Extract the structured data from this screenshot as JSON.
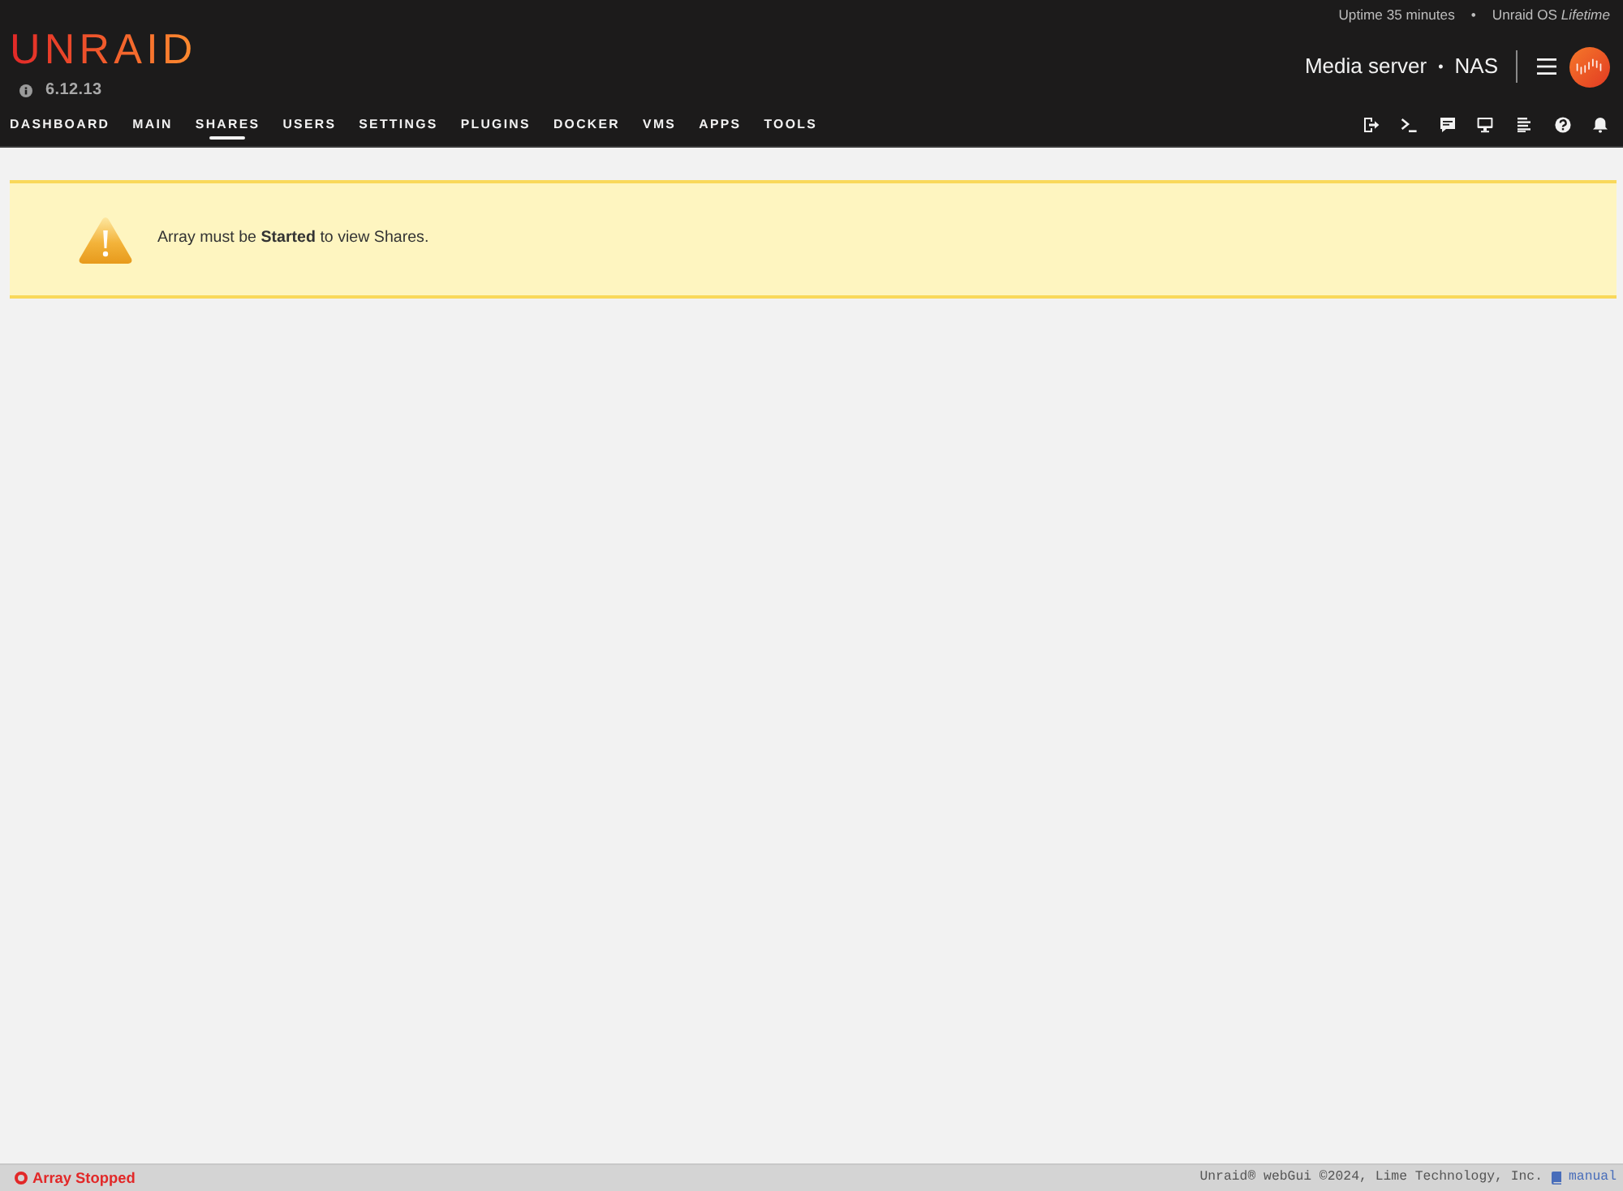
{
  "header": {
    "logo": "UNRAID",
    "version": "6.12.13",
    "uptime": "Uptime 35 minutes",
    "separator": "•",
    "license": "Unraid OS *Lifetime*",
    "server_name": "Media server",
    "server_separator": "•",
    "server_description": "NAS"
  },
  "nav": {
    "tabs": [
      {
        "label": "DASHBOARD",
        "selected": false
      },
      {
        "label": "MAIN",
        "selected": false
      },
      {
        "label": "SHARES",
        "selected": true
      },
      {
        "label": "USERS",
        "selected": false
      },
      {
        "label": "SETTINGS",
        "selected": false
      },
      {
        "label": "PLUGINS",
        "selected": false
      },
      {
        "label": "DOCKER",
        "selected": false
      },
      {
        "label": "VMS",
        "selected": false
      },
      {
        "label": "APPS",
        "selected": false
      },
      {
        "label": "TOOLS",
        "selected": false
      }
    ]
  },
  "notice": {
    "kind": "warning",
    "text": "Array must be **Started** to view Shares."
  },
  "footer": {
    "array": {
      "started": false,
      "label": "Array Stopped"
    },
    "copyright": "Unraid® webGui ©2024, Lime Technology, Inc.",
    "manual_link": "manual"
  }
}
